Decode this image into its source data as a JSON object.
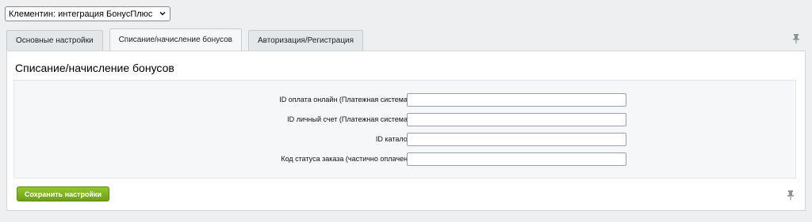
{
  "site_selector": {
    "value": "Клементин: интеграция БонусПлюс"
  },
  "tabs": [
    {
      "label": "Основные настройки",
      "active": false
    },
    {
      "label": "Списание/начисление бонусов",
      "active": true
    },
    {
      "label": "Авторизация/Регистрация",
      "active": false
    }
  ],
  "panel": {
    "title": "Списание/начисление бонусов",
    "fields": [
      {
        "label": "ID оплата онлайн (Платежная система)",
        "value": ""
      },
      {
        "label": "ID личный счет (Платежная система)",
        "value": ""
      },
      {
        "label": "ID каталог",
        "value": ""
      },
      {
        "label": "Код статуса заказа (частично оплачен)",
        "value": ""
      }
    ],
    "save_label": "Сохранить настройки"
  },
  "icons": {
    "pin": "pin-icon",
    "select_arrow": "chevron-down-icon"
  },
  "colors": {
    "accent_green": "#7ab51d",
    "page_bg": "#edeff0"
  }
}
